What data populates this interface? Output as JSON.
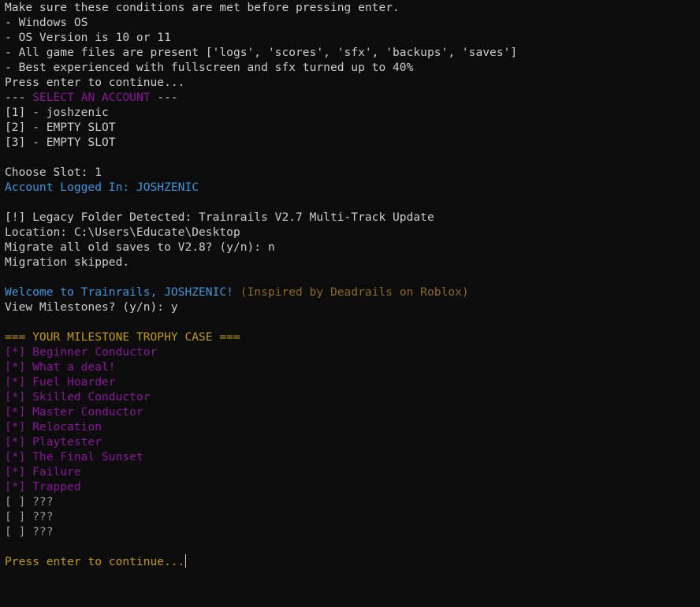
{
  "terminal": {
    "conditions_heading": "Make sure these conditions are met before pressing enter.",
    "conditions": [
      "- Windows OS",
      "- OS Version is 10 or 11",
      "- All game files are present ['logs', 'scores', 'sfx', 'backups', 'saves']",
      "- Best experienced with fullscreen and sfx turned up to 40%"
    ],
    "press_enter_1": "Press enter to continue...",
    "account_header_left": "--- ",
    "account_header_title": "SELECT AN ACCOUNT",
    "account_header_right": " ---",
    "slots": [
      "[1] - joshzenic",
      "[2] - EMPTY SLOT",
      "[3] - EMPTY SLOT"
    ],
    "choose_slot": "Choose Slot: 1",
    "logged_in": "Account Logged In: JOSHZENIC",
    "legacy_detected": "[!] Legacy Folder Detected: Trainrails V2.7 Multi-Track Update",
    "location": "Location: C:\\Users\\Educate\\Desktop",
    "migrate_prompt": "Migrate all old saves to V2.8? (y/n): n",
    "migration_skipped": "Migration skipped.",
    "welcome": "Welcome to Trainrails, JOSHZENIC!",
    "inspired": " (Inspired by Deadrails on Roblox)",
    "view_milestones": "View Milestones? (y/n): y",
    "trophy_header": "=== YOUR MILESTONE TROPHY CASE ===",
    "milestones_unlocked": [
      "[*] Beginner Conductor",
      "[*] What a deal!",
      "[*] Fuel Hoarder",
      "[*] Skilled Conductor",
      "[*] Master Conductor",
      "[*] Relocation",
      "[*] Playtester",
      "[*] The Final Sunset",
      "[*] Failure",
      "[*] Trapped"
    ],
    "milestones_locked": [
      "[ ] ???",
      "[ ] ???",
      "[ ] ???"
    ],
    "press_enter_2": "Press enter to continue..."
  },
  "colors": {
    "background": "#0c0c0c",
    "text": "#cccccc",
    "purple": "#881798",
    "blue": "#3a96dd",
    "brown": "#8b6a16",
    "gold": "#c19c00"
  }
}
